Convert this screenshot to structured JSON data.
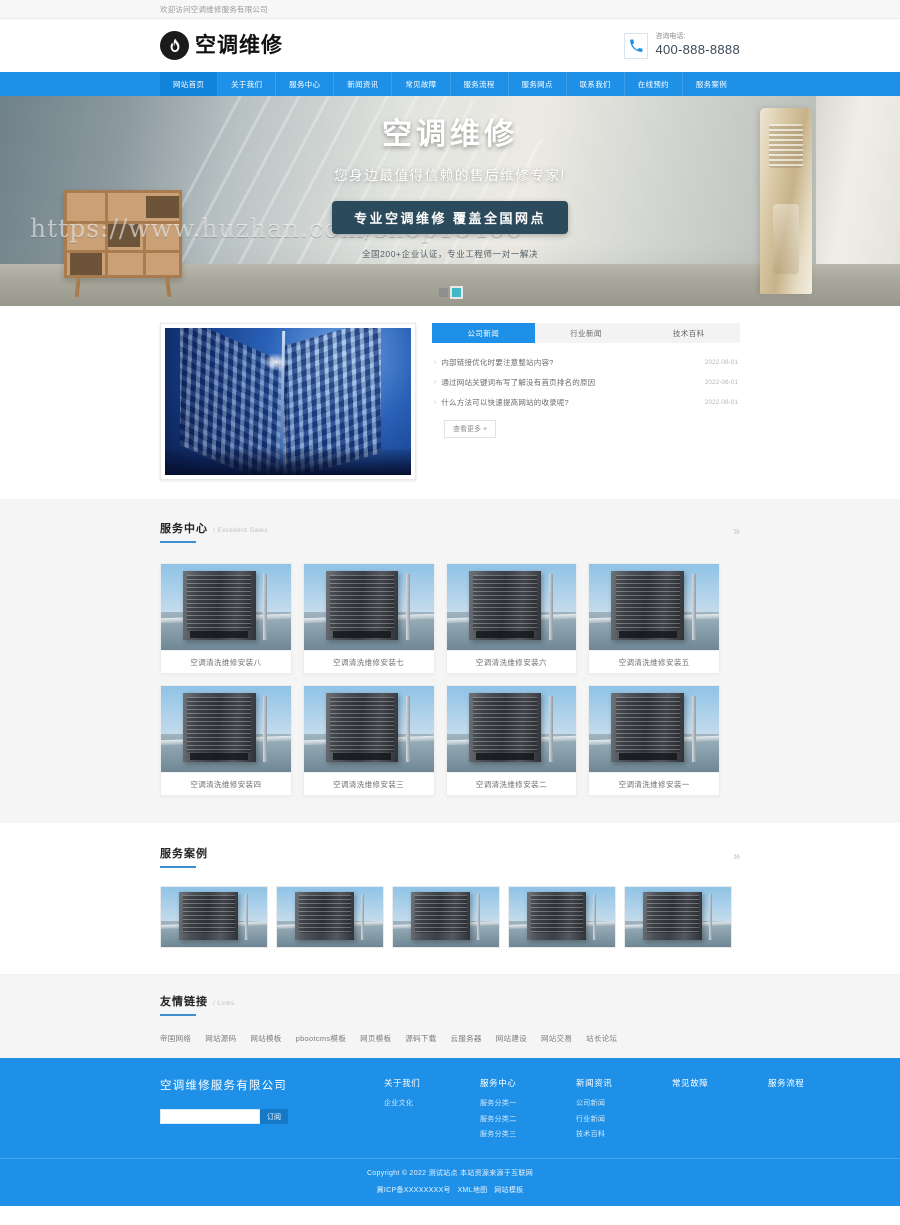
{
  "topbar": {
    "welcome": "欢迎访问空调维修服务有限公司"
  },
  "header": {
    "logo_text": "空调维修",
    "logo_icon": "flame-circle-icon",
    "phone_icon": "telephone-icon",
    "phone_label": "咨询电话:",
    "phone_number": "400-888-8888"
  },
  "nav": {
    "items": [
      {
        "label": "网站首页",
        "active": true
      },
      {
        "label": "关于我们",
        "active": false
      },
      {
        "label": "服务中心",
        "active": false
      },
      {
        "label": "新闻资讯",
        "active": false
      },
      {
        "label": "常见故障",
        "active": false
      },
      {
        "label": "服务流程",
        "active": false
      },
      {
        "label": "服务网点",
        "active": false
      },
      {
        "label": "联系我们",
        "active": false
      },
      {
        "label": "在线预约",
        "active": false
      },
      {
        "label": "服务案例",
        "active": false
      }
    ]
  },
  "hero": {
    "watermark": "https://www.huzhan.com/shop15466",
    "title": "空调维修",
    "subtitle": "您身边最值得信赖的售后维修专家!",
    "button": "专业空调维修  覆盖全国网点",
    "note": "全国200+企业认证，专业工程师一对一解决",
    "slides": [
      {
        "label": "1",
        "active": false
      },
      {
        "label": "2",
        "active": true
      }
    ]
  },
  "news": {
    "tabs": [
      {
        "label": "公司新闻",
        "active": true
      },
      {
        "label": "行业新闻",
        "active": false
      },
      {
        "label": "技术百科",
        "active": false
      }
    ],
    "items": [
      {
        "title": "内部链接优化时要注意整站内容?",
        "date": "2022-08-01"
      },
      {
        "title": "通过网站关键词布写了解没有首页排名的原因",
        "date": "2022-08-01"
      },
      {
        "title": "什么方法可以快速提高网站的收录呢?",
        "date": "2022-08-01"
      }
    ],
    "more": "查看更多 +",
    "image_alt": "office-building-photo"
  },
  "service": {
    "title_cn": "服务中心",
    "title_en": "/ Excellent Sales",
    "more_icon": "chevron-right-icon",
    "cards": [
      {
        "label": "空调清洗维修安装八"
      },
      {
        "label": "空调清洗维修安装七"
      },
      {
        "label": "空调清洗维修安装六"
      },
      {
        "label": "空调清洗维修安装五"
      },
      {
        "label": "空调清洗维修安装四"
      },
      {
        "label": "空调清洗维修安装三"
      },
      {
        "label": "空调清洗维修安装二"
      },
      {
        "label": "空调清洗维修安装一"
      }
    ]
  },
  "cases": {
    "title_cn": "服务案例",
    "title_en": "",
    "more_icon": "chevron-right-icon",
    "items": [
      {
        "alt": "air-conditioner-case-1"
      },
      {
        "alt": "air-conditioner-case-2"
      },
      {
        "alt": "air-conditioner-case-3"
      },
      {
        "alt": "air-conditioner-case-4"
      },
      {
        "alt": "air-conditioner-case-5"
      }
    ]
  },
  "links": {
    "title_cn": "友情链接",
    "title_en": "/ Links",
    "items": [
      {
        "label": "帝国网络"
      },
      {
        "label": "网站源码"
      },
      {
        "label": "网站模板"
      },
      {
        "label": "pbootcms模板"
      },
      {
        "label": "网页模板"
      },
      {
        "label": "源码下载"
      },
      {
        "label": "云服务器"
      },
      {
        "label": "网站建设"
      },
      {
        "label": "网站交易"
      },
      {
        "label": "站长论坛"
      }
    ]
  },
  "footer": {
    "brand": "空调维修服务有限公司",
    "subscribe_placeholder": "",
    "subscribe_value": "",
    "subscribe_button": "订阅",
    "columns": [
      {
        "heading": "关于我们",
        "items": [
          {
            "label": "企业文化"
          }
        ]
      },
      {
        "heading": "服务中心",
        "items": [
          {
            "label": "服务分类一"
          },
          {
            "label": "服务分类二"
          },
          {
            "label": "服务分类三"
          }
        ]
      },
      {
        "heading": "新闻资讯",
        "items": [
          {
            "label": "公司新闻"
          },
          {
            "label": "行业新闻"
          },
          {
            "label": "技术百科"
          }
        ]
      },
      {
        "heading": "常见故障",
        "items": []
      },
      {
        "heading": "服务流程",
        "items": []
      }
    ],
    "copyright": "Copyright © 2022 测试站点 本站资源来源于互联网",
    "icp": "冀ICP备XXXXXXXX号",
    "xml": "XML地图",
    "tpl": "网站模板"
  },
  "colors": {
    "brand_blue": "#1e90e8",
    "nav_active": "#1283db",
    "accent_line": "#3e8fd0",
    "hero_btn": "#2b4a5c",
    "slide_active": "#3fb8c8"
  }
}
